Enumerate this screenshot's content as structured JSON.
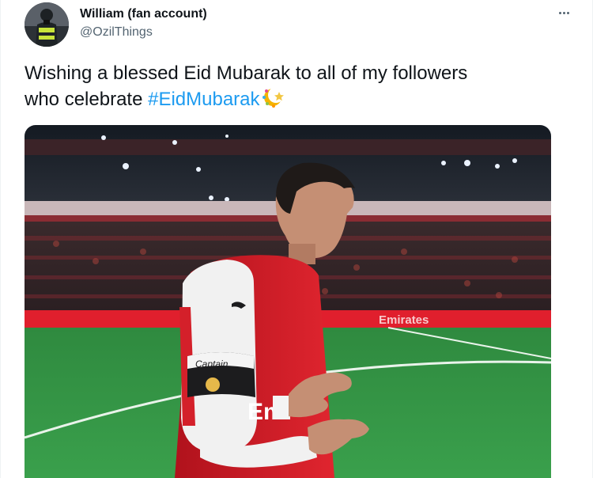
{
  "tweet": {
    "author": {
      "display_name": "William (fan account)",
      "handle": "@OzilThings",
      "avatar_icon": "user-avatar"
    },
    "more_icon": "more-horizontal-icon",
    "text_line1": "Wishing a blessed Eid Mubarak to all of my followers",
    "text_line2_prefix": "who celebrate ",
    "hashtag": "#EidMubarak",
    "emoji_icon": "crescent-moon-star-emoji",
    "media": {
      "description_icon": "photo",
      "stadium_board_text": "Emirates",
      "armband_text": "Captain",
      "shirt_sponsor": "Em"
    }
  },
  "colors": {
    "text": "#0f1419",
    "secondary": "#536471",
    "link": "#1d9bf0",
    "kit_red": "#d4202a"
  }
}
